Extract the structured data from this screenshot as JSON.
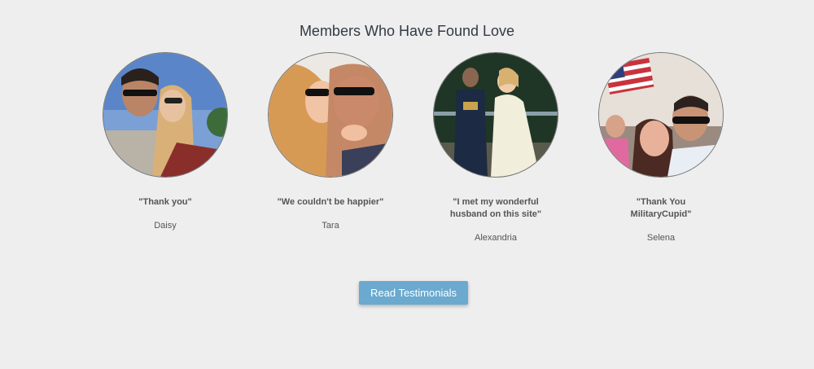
{
  "section": {
    "title": "Members Who Have Found Love"
  },
  "members": [
    {
      "quote": "\"Thank you\"",
      "name": "Daisy"
    },
    {
      "quote": "\"We couldn't be happier\"",
      "name": "Tara"
    },
    {
      "quote": "\"I met my wonderful husband on this site\"",
      "name": "Alexandria"
    },
    {
      "quote": "\"Thank You MilitaryCupid\"",
      "name": "Selena"
    }
  ],
  "cta": {
    "label": "Read Testimonials"
  },
  "colors": {
    "background": "#eeeeee",
    "button": "#6ba9cf",
    "title": "#333a44",
    "text": "#555555"
  }
}
